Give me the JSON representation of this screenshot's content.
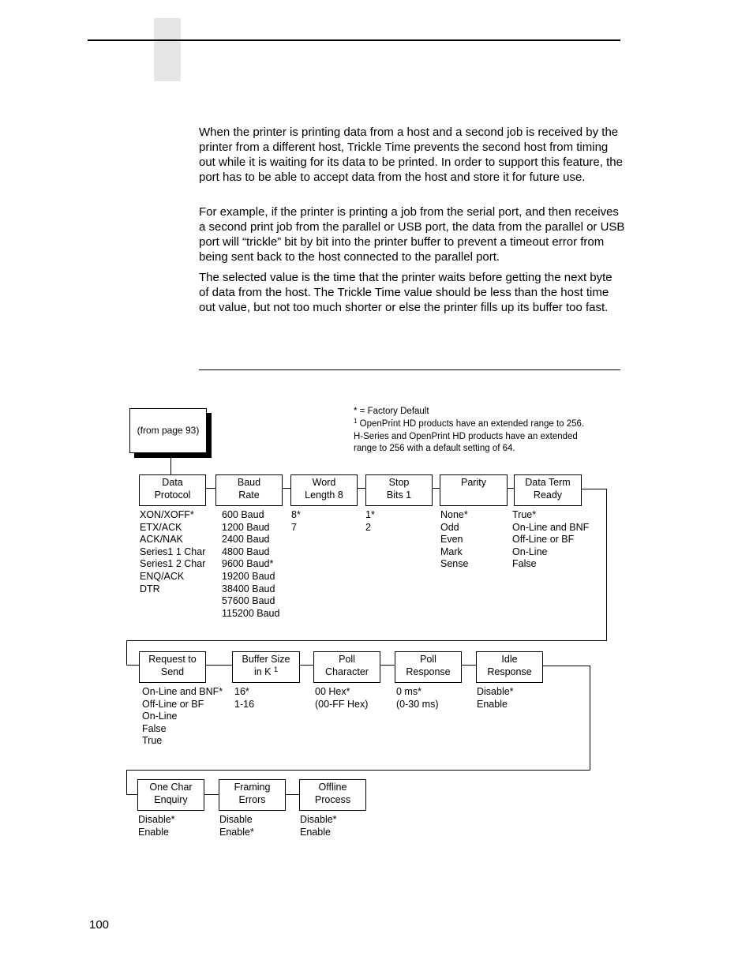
{
  "page": {
    "page_number": "100",
    "paragraphs": [
      "When the printer is printing data from a host and a second job is received by the printer from a different host, Trickle Time prevents the second host from timing out while it is waiting for its data to be printed. In order to support this feature, the port has to be able to accept data from the host and store it for future use.",
      "For example, if the printer is printing a job from the serial port, and then receives a second print job from the parallel or USB port, the data from the parallel or USB port will “trickle” bit by bit into the printer buffer to prevent a timeout error from being sent back to the host connected to the parallel port.",
      "The selected value is the time that the printer waits before getting the next byte of data from the host. The Trickle Time value should be less than the host time out value, but not too much shorter or else the printer fills up its buffer too fast."
    ]
  },
  "diagram": {
    "entry_box": "(from page 93)",
    "notes": {
      "default_legend": "* = Factory Default",
      "footnote_mark": "1",
      "footnote_lines": [
        "OpenPrint HD products have an extended range to 256.",
        "H-Series and OpenPrint HD products have an extended",
        "range to 256 with a default setting of 64."
      ]
    },
    "row1": [
      {
        "title": [
          "Data",
          "Protocol"
        ],
        "options": [
          "XON/XOFF*",
          "ETX/ACK",
          "ACK/NAK",
          "Series1 1 Char",
          "Series1 2 Char",
          "ENQ/ACK",
          "DTR"
        ]
      },
      {
        "title": [
          "Baud",
          "Rate"
        ],
        "options": [
          "600 Baud",
          "1200 Baud",
          "2400 Baud",
          "4800 Baud",
          "9600 Baud*",
          "19200 Baud",
          "38400 Baud",
          "57600 Baud",
          "115200 Baud"
        ]
      },
      {
        "title": [
          "Word",
          "Length 8"
        ],
        "options": [
          "8*",
          "7"
        ]
      },
      {
        "title": [
          "Stop",
          "Bits 1"
        ],
        "options": [
          "1*",
          "2"
        ]
      },
      {
        "title": [
          "Parity",
          ""
        ],
        "options": [
          "None*",
          "Odd",
          "Even",
          "Mark",
          "Sense"
        ]
      },
      {
        "title": [
          "Data Term",
          "Ready"
        ],
        "options": [
          "True*",
          "On-Line and BNF",
          "Off-Line or BF",
          "On-Line",
          "False"
        ]
      }
    ],
    "row2": [
      {
        "title": [
          "Request to",
          "Send"
        ],
        "options": [
          "On-Line and BNF*",
          "Off-Line or BF",
          "On-Line",
          "False",
          "True"
        ]
      },
      {
        "title": [
          "Buffer Size",
          "in K"
        ],
        "footnote": "1",
        "options": [
          "16*",
          "1-16"
        ]
      },
      {
        "title": [
          "Poll",
          "Character"
        ],
        "options": [
          "00 Hex*",
          "(00-FF Hex)"
        ]
      },
      {
        "title": [
          "Poll",
          "Response"
        ],
        "options": [
          "0 ms*",
          "(0-30 ms)"
        ]
      },
      {
        "title": [
          "Idle",
          "Response"
        ],
        "options": [
          "Disable*",
          "Enable"
        ]
      }
    ],
    "row3": [
      {
        "title": [
          "One Char",
          "Enquiry"
        ],
        "options": [
          "Disable*",
          "Enable"
        ]
      },
      {
        "title": [
          "Framing",
          "Errors"
        ],
        "options": [
          "Disable",
          "Enable*"
        ]
      },
      {
        "title": [
          "Offline",
          "Process"
        ],
        "options": [
          "Disable*",
          "Enable"
        ]
      }
    ]
  }
}
